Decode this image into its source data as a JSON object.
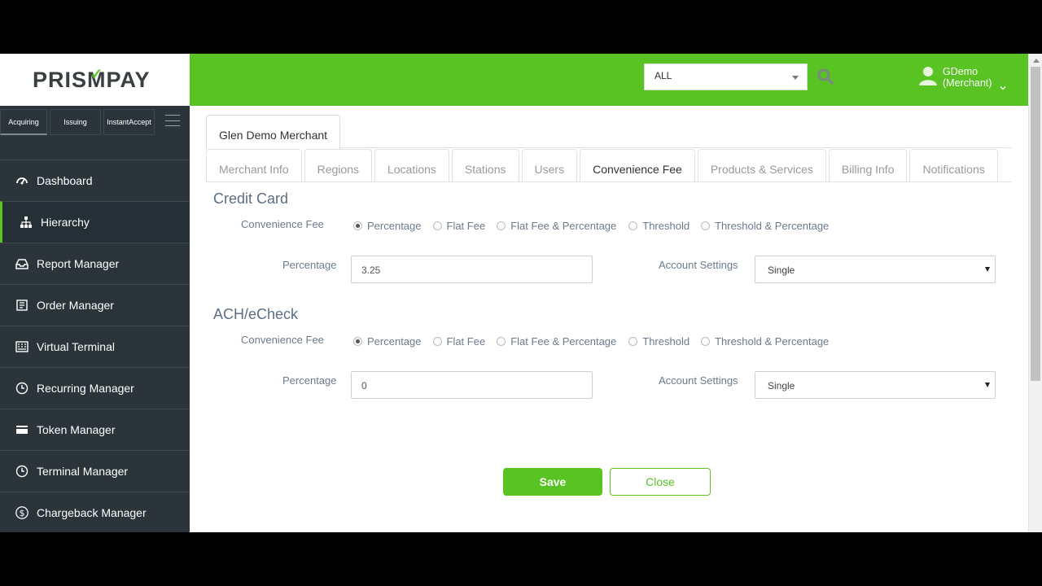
{
  "brand": {
    "logo_text": "PRISMPAY",
    "accent": "#58c322",
    "sidebar_bg": "#2b3438"
  },
  "sidebar": {
    "switches": [
      {
        "label": "Acquiring",
        "active": true
      },
      {
        "label": "Issuing",
        "active": false
      },
      {
        "label": "InstantAccept",
        "active": false
      }
    ],
    "menu_icon": "hamburger-icon",
    "items": [
      {
        "label": "Dashboard",
        "icon": "dashboard-icon"
      },
      {
        "label": "Hierarchy",
        "icon": "hierarchy-icon",
        "active": true
      },
      {
        "label": "Report Manager",
        "icon": "inbox-icon"
      },
      {
        "label": "Order Manager",
        "icon": "order-icon"
      },
      {
        "label": "Virtual Terminal",
        "icon": "keyboard-icon"
      },
      {
        "label": "Recurring Manager",
        "icon": "clock-icon"
      },
      {
        "label": "Token Manager",
        "icon": "card-icon"
      },
      {
        "label": "Terminal Manager",
        "icon": "clock-icon"
      },
      {
        "label": "Chargeback Manager",
        "icon": "dollar-icon"
      }
    ]
  },
  "header": {
    "scope_value": "ALL",
    "user_name": "GDemo",
    "user_role": "(Merchant)"
  },
  "main": {
    "merchant_tab": "Glen Demo Merchant",
    "tabs": [
      {
        "label": "Merchant Info"
      },
      {
        "label": "Regions"
      },
      {
        "label": "Locations"
      },
      {
        "label": "Stations"
      },
      {
        "label": "Users"
      },
      {
        "label": "Convenience Fee",
        "active": true
      },
      {
        "label": "Products & Services"
      },
      {
        "label": "Billing Info"
      },
      {
        "label": "Notifications"
      }
    ],
    "sections": [
      {
        "title": "Credit Card",
        "fee_label": "Convenience Fee",
        "options": [
          "Percentage",
          "Flat Fee",
          "Flat Fee & Percentage",
          "Threshold",
          "Threshold & Percentage"
        ],
        "selected": "Percentage",
        "percentage_label": "Percentage",
        "percentage_value": "3.25",
        "account_label": "Account Settings",
        "account_value": "Single"
      },
      {
        "title": "ACH/eCheck",
        "fee_label": "Convenience Fee",
        "options": [
          "Percentage",
          "Flat Fee",
          "Flat Fee & Percentage",
          "Threshold",
          "Threshold & Percentage"
        ],
        "selected": "Percentage",
        "percentage_label": "Percentage",
        "percentage_value": "0",
        "account_label": "Account Settings",
        "account_value": "Single"
      }
    ],
    "save_label": "Save",
    "close_label": "Close"
  }
}
